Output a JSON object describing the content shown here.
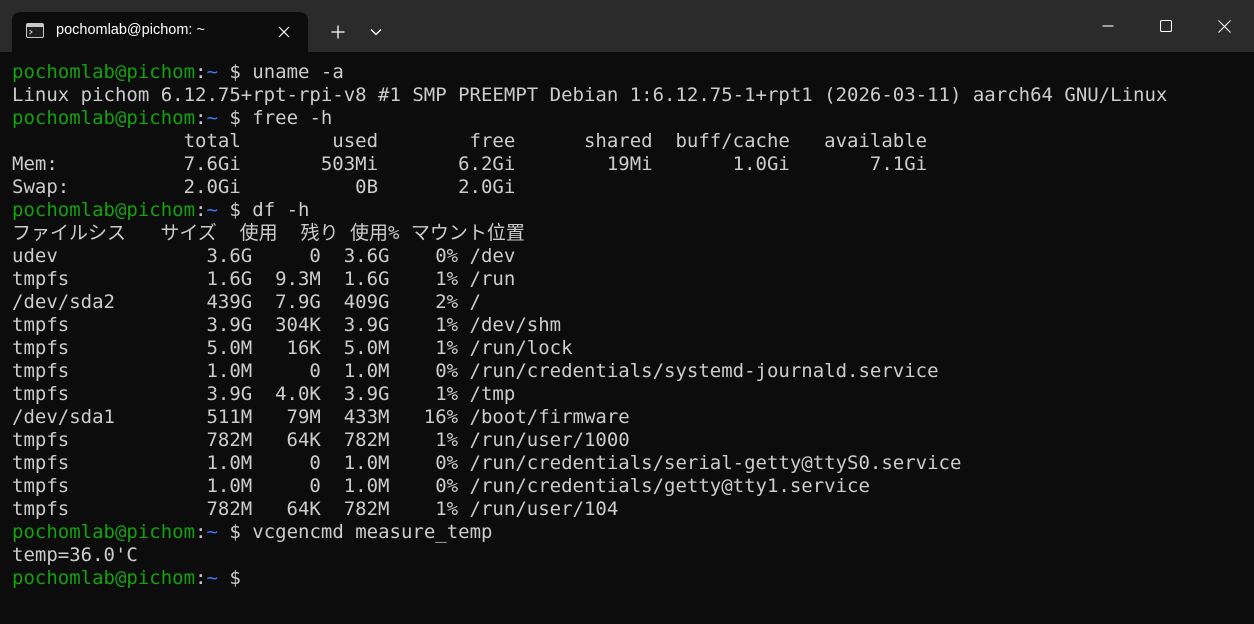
{
  "window": {
    "tab_title": "pochomlab@pichom: ~",
    "icons": {
      "tab": "terminal-icon",
      "close_tab": "close-icon",
      "new_tab": "plus-icon",
      "dropdown": "chevron-down-icon",
      "minimize": "minimize-icon",
      "maximize": "maximize-icon",
      "close": "close-icon"
    }
  },
  "colors": {
    "background": "#0c0c0c",
    "titlebar": "#2b2b2b",
    "prompt_user": "#13a10e",
    "prompt_path": "#3b78ff",
    "text": "#cccccc"
  },
  "terminal": {
    "lines": [
      {
        "type": "prompt",
        "user": "pochomlab@pichom",
        "sep": ":",
        "path": "~",
        "symbol": " $ ",
        "cmd": "uname -a"
      },
      {
        "type": "output",
        "text": "Linux pichom 6.12.75+rpt-rpi-v8 #1 SMP PREEMPT Debian 1:6.12.75-1+rpt1 (2026-03-11) aarch64 GNU/Linux"
      },
      {
        "type": "prompt",
        "user": "pochomlab@pichom",
        "sep": ":",
        "path": "~",
        "symbol": " $ ",
        "cmd": "free -h"
      },
      {
        "type": "output",
        "text": "               total        used        free      shared  buff/cache   available"
      },
      {
        "type": "output",
        "text": "Mem:           7.6Gi       503Mi       6.2Gi        19Mi       1.0Gi       7.1Gi"
      },
      {
        "type": "output",
        "text": "Swap:          2.0Gi          0B       2.0Gi"
      },
      {
        "type": "prompt",
        "user": "pochomlab@pichom",
        "sep": ":",
        "path": "~",
        "symbol": " $ ",
        "cmd": "df -h"
      },
      {
        "type": "output",
        "text": "ファイルシス   サイズ  使用  残り 使用% マウント位置"
      },
      {
        "type": "output",
        "text": "udev             3.6G     0  3.6G    0% /dev"
      },
      {
        "type": "output",
        "text": "tmpfs            1.6G  9.3M  1.6G    1% /run"
      },
      {
        "type": "output",
        "text": "/dev/sda2        439G  7.9G  409G    2% /"
      },
      {
        "type": "output",
        "text": "tmpfs            3.9G  304K  3.9G    1% /dev/shm"
      },
      {
        "type": "output",
        "text": "tmpfs            5.0M   16K  5.0M    1% /run/lock"
      },
      {
        "type": "output",
        "text": "tmpfs            1.0M     0  1.0M    0% /run/credentials/systemd-journald.service"
      },
      {
        "type": "output",
        "text": "tmpfs            3.9G  4.0K  3.9G    1% /tmp"
      },
      {
        "type": "output",
        "text": "/dev/sda1        511M   79M  433M   16% /boot/firmware"
      },
      {
        "type": "output",
        "text": "tmpfs            782M   64K  782M    1% /run/user/1000"
      },
      {
        "type": "output",
        "text": "tmpfs            1.0M     0  1.0M    0% /run/credentials/serial-getty@ttyS0.service"
      },
      {
        "type": "output",
        "text": "tmpfs            1.0M     0  1.0M    0% /run/credentials/getty@tty1.service"
      },
      {
        "type": "output",
        "text": "tmpfs            782M   64K  782M    1% /run/user/104"
      },
      {
        "type": "prompt",
        "user": "pochomlab@pichom",
        "sep": ":",
        "path": "~",
        "symbol": " $ ",
        "cmd": "vcgencmd measure_temp"
      },
      {
        "type": "output",
        "text": "temp=36.0'C"
      },
      {
        "type": "prompt",
        "user": "pochomlab@pichom",
        "sep": ":",
        "path": "~",
        "symbol": " $",
        "cmd": ""
      }
    ]
  }
}
